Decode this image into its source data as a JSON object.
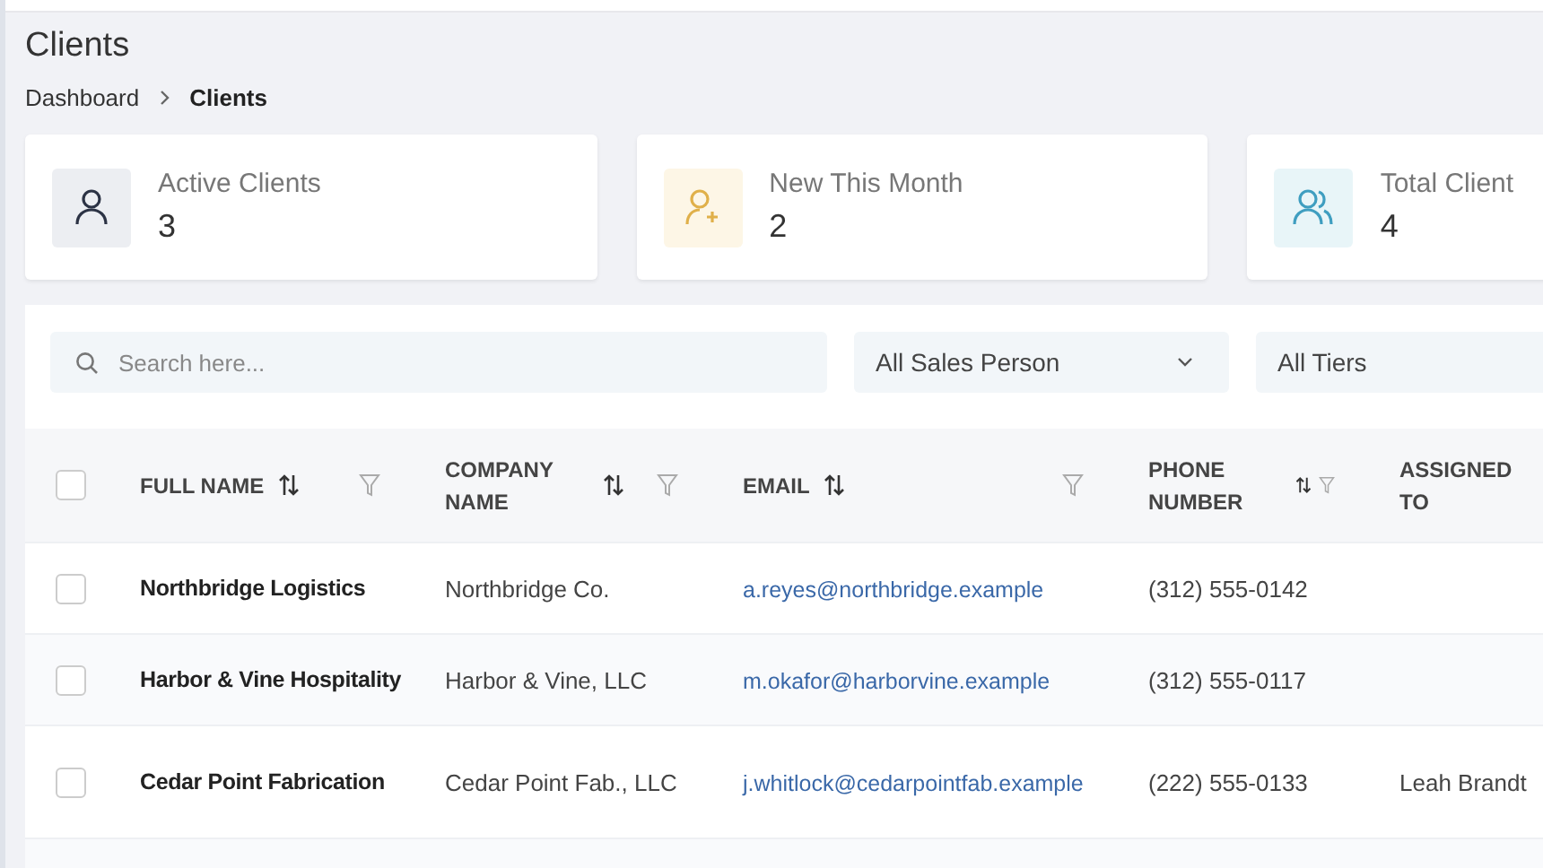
{
  "page": {
    "title": "Clients"
  },
  "breadcrumb": [
    {
      "label": "Dashboard",
      "current": false
    },
    {
      "label": "Clients",
      "current": true
    }
  ],
  "stats": [
    {
      "kind": "person",
      "label": "Active Clients",
      "value": "3"
    },
    {
      "kind": "person-add",
      "label": "New This Month",
      "value": "2"
    },
    {
      "kind": "people",
      "label": "Total Client",
      "value": "4"
    }
  ],
  "filters": {
    "search": {
      "placeholder": "Search here..."
    },
    "dropdowns": [
      {
        "value": "All Sales Person"
      },
      {
        "value": "All Tiers"
      }
    ]
  },
  "table": {
    "select_all_checked": false,
    "columns": [
      {
        "label": "FULL NAME",
        "filter": true
      },
      {
        "label": "COMPANY NAME",
        "filter": true
      },
      {
        "label": "EMAIL",
        "filter": true
      },
      {
        "label": "PHONE NUMBER",
        "filter": true
      },
      {
        "label": "ASSIGNED TO",
        "filter": false
      }
    ],
    "rows": [
      {
        "checked": false,
        "full_name": "Northbridge Logistics",
        "company": "Northbridge Co.",
        "email": "a.reyes@northbridge.example",
        "phone": "(312) 555-0142"
      },
      {
        "checked": false,
        "full_name": "Harbor & Vine Hospitality",
        "company": "Harbor & Vine, LLC",
        "email": "m.okafor@harborvine.example",
        "phone": "(312) 555-0117"
      },
      {
        "checked": false,
        "full_name": "Cedar Point Fabrication",
        "company": "Cedar Point Fab., LLC",
        "email": "j.whitlock@cedarpointfab.example",
        "phone": "(222) 555-0133",
        "assigned_to": "Leah Brandt"
      }
    ]
  }
}
